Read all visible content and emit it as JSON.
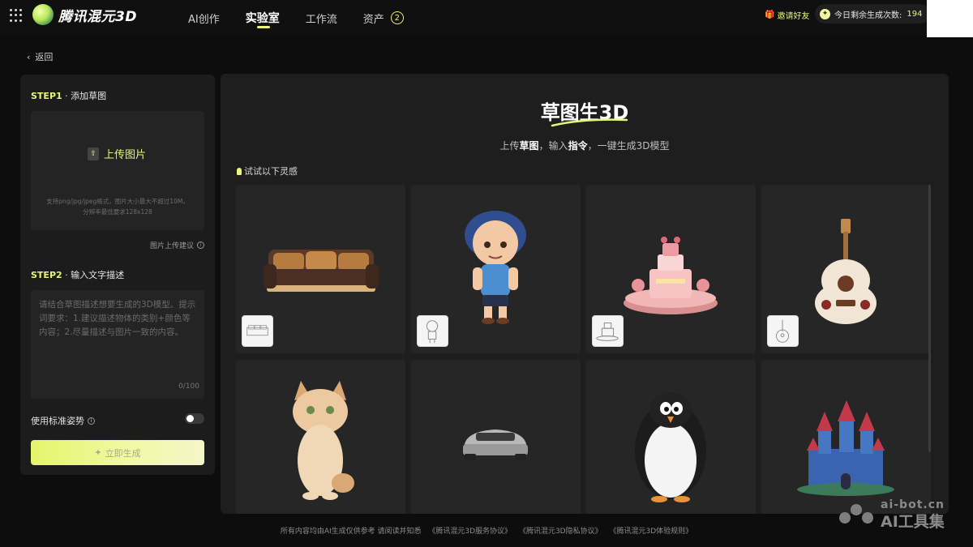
{
  "header": {
    "logo_text": "腾讯混元3D",
    "nav": [
      {
        "label": "AI创作",
        "active": false
      },
      {
        "label": "实验室",
        "active": true
      },
      {
        "label": "工作流",
        "active": false
      },
      {
        "label": "资产",
        "active": false
      }
    ],
    "asset_badge": "2",
    "invite_label": "邀请好友",
    "quota_label": "今日剩余生成次数:",
    "quota_value": "194"
  },
  "back_label": "返回",
  "left_panel": {
    "step1_prefix": "STEP1",
    "step1_label": "· 添加草图",
    "upload_label": "上传图片",
    "upload_hint_1": "支持png/jpg/jpeg格式，图片大小最大不超过10M，",
    "upload_hint_2": "分辨率最低要求128x128",
    "upload_suggest": "图片上传建议",
    "step2_prefix": "STEP2",
    "step2_label": "· 输入文字描述",
    "prompt_placeholder": "请结合草图描述想要生成的3D模型。提示词要求：1.建议描述物体的类别+颜色等内容；2.尽量描述与图片一致的内容。",
    "char_count": "0/100",
    "pose_label": "使用标准姿势",
    "pose_enabled": false,
    "generate_label": "立即生成"
  },
  "main": {
    "title": "草图生3D",
    "subtitle_1": "上传",
    "subtitle_b1": "草图",
    "subtitle_2": "，输入",
    "subtitle_b2": "指令",
    "subtitle_3": "，一键生成3D模型",
    "inspire_label": "试试以下灵感",
    "cards": [
      {
        "subject": "sofa-model"
      },
      {
        "subject": "boy-character-model"
      },
      {
        "subject": "cake-model"
      },
      {
        "subject": "guitar-model"
      },
      {
        "subject": "cat-model"
      },
      {
        "subject": "car-model"
      },
      {
        "subject": "penguin-model"
      },
      {
        "subject": "castle-model"
      }
    ]
  },
  "footer": {
    "text": "所有内容均由AI生成仅供参考 请阅读并知悉",
    "links": [
      "《腾讯混元3D服务协议》",
      "《腾讯混元3D隐私协议》",
      "《腾讯混元3D体验规则》"
    ]
  },
  "watermark": {
    "line1": "ai-bot.cn",
    "line2": "AI工具集"
  },
  "colors": {
    "accent": "#e8f578",
    "background": "#0d0d0d",
    "panel": "#1e1e1e"
  }
}
